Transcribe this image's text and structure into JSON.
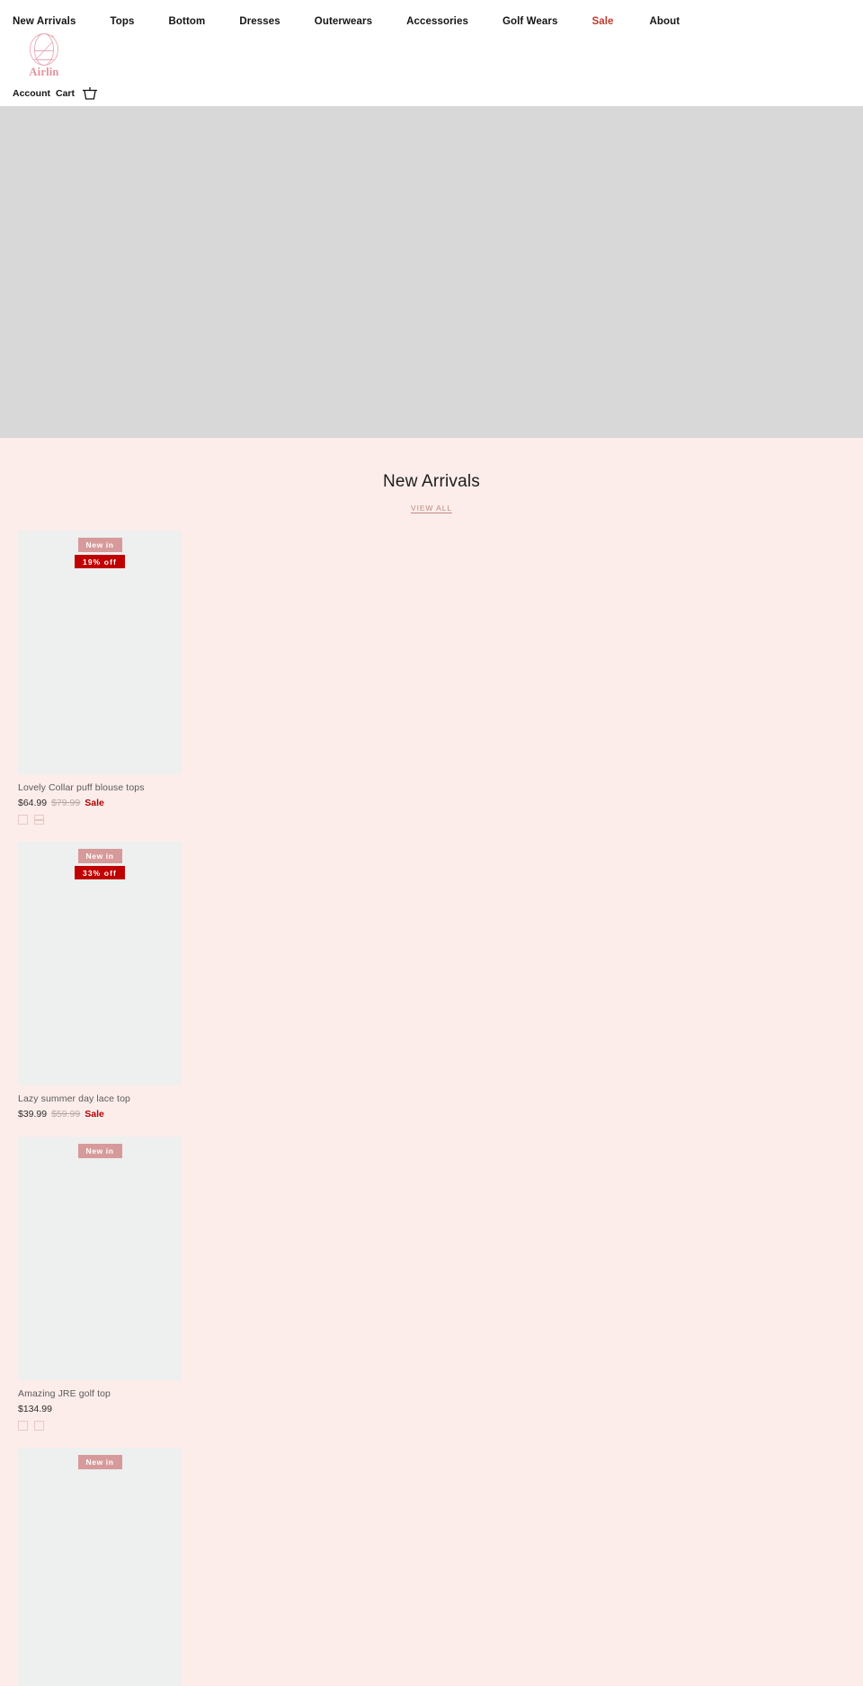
{
  "brand": {
    "name": "Airlin",
    "logo_icon": "airlin-monogram-icon",
    "logo_color": "#E3919C"
  },
  "header": {
    "nav": [
      {
        "label": "New Arrivals",
        "style": "default"
      },
      {
        "label": "Tops",
        "style": "default"
      },
      {
        "label": "Bottom",
        "style": "default"
      },
      {
        "label": "Dresses",
        "style": "default"
      },
      {
        "label": "Outerwears",
        "style": "default"
      },
      {
        "label": "Accessories",
        "style": "default"
      },
      {
        "label": "Golf Wears",
        "style": "default"
      },
      {
        "label": "Sale",
        "style": "sale"
      },
      {
        "label": "About",
        "style": "default"
      }
    ],
    "account_label": "Account",
    "cart_label": "Cart",
    "cart_icon": "shopping-basket-icon"
  },
  "hero": {
    "placeholder_color": "#D8D8D8"
  },
  "section": {
    "title": "New Arrivals",
    "view_all_label": "VIEW ALL"
  },
  "colors": {
    "page_background": "#FDEDEA",
    "badge_new": "#D79A9A",
    "badge_off": "#C00000",
    "sale_text": "#B00000",
    "nav_sale": "#C0392B",
    "image_placeholder": "#EEEFEF"
  },
  "products": [
    {
      "title": "Lovely Collar puff blouse tops",
      "price": "$64.99",
      "compare_at_price": "$79.99",
      "sale_label": "Sale",
      "badge_new": "New in",
      "badge_off": "19% off",
      "swatches": [
        "plain",
        "lined"
      ]
    },
    {
      "title": "Lazy summer day lace top",
      "price": "$39.99",
      "compare_at_price": "$59.99",
      "sale_label": "Sale",
      "badge_new": "New in",
      "badge_off": "33% off",
      "swatches": []
    },
    {
      "title": "Amazing JRE golf top",
      "price": "$134.99",
      "compare_at_price": "",
      "sale_label": "",
      "badge_new": "New in",
      "badge_off": "",
      "swatches": [
        "plain",
        "plain"
      ]
    },
    {
      "title": "",
      "price": "",
      "compare_at_price": "",
      "sale_label": "",
      "badge_new": "New in",
      "badge_off": "",
      "swatches": []
    }
  ]
}
